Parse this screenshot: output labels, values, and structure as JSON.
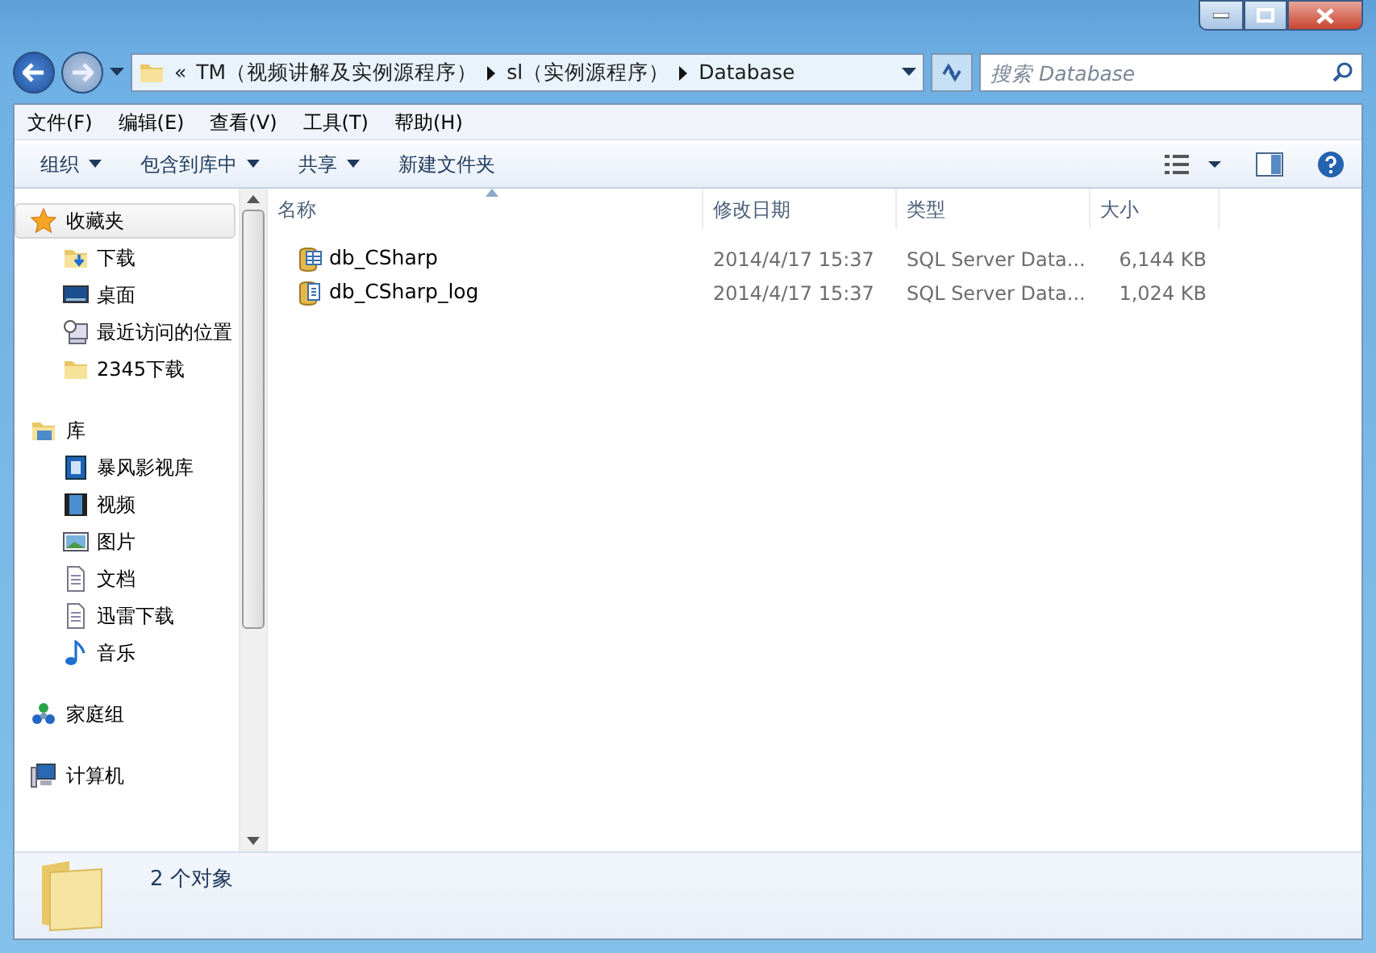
{
  "address": {
    "overflow": "«",
    "crumbs": [
      "TM（视频讲解及实例源程序）",
      "sl（实例源程序）",
      "Database"
    ]
  },
  "search": {
    "placeholder": "搜索 Database"
  },
  "menu": [
    "文件(F)",
    "编辑(E)",
    "查看(V)",
    "工具(T)",
    "帮助(H)"
  ],
  "toolbar": [
    {
      "label": "组织",
      "dropdown": true
    },
    {
      "label": "包含到库中",
      "dropdown": true
    },
    {
      "label": "共享",
      "dropdown": true
    },
    {
      "label": "新建文件夹",
      "dropdown": false
    }
  ],
  "navigation": [
    {
      "label": "收藏夹",
      "kind": "star",
      "selected": true,
      "children": [
        {
          "label": "下载",
          "kind": "download",
          "selected": false
        },
        {
          "label": "桌面",
          "kind": "desktop",
          "selected": false
        },
        {
          "label": "最近访问的位置",
          "kind": "recent",
          "selected": false
        },
        {
          "label": "2345下载",
          "kind": "folder",
          "selected": false
        }
      ]
    },
    {
      "label": "库",
      "kind": "library",
      "selected": false,
      "children": [
        {
          "label": "暴风影视库",
          "kind": "media",
          "selected": false
        },
        {
          "label": "视频",
          "kind": "video",
          "selected": false
        },
        {
          "label": "图片",
          "kind": "picture",
          "selected": false
        },
        {
          "label": "文档",
          "kind": "document",
          "selected": false
        },
        {
          "label": "迅雷下载",
          "kind": "document",
          "selected": false
        },
        {
          "label": "音乐",
          "kind": "music",
          "selected": false
        }
      ]
    },
    {
      "label": "家庭组",
      "kind": "homegroup",
      "selected": false
    },
    {
      "label": "计算机",
      "kind": "computer",
      "selected": false
    }
  ],
  "table": {
    "columns": [
      {
        "label": "名称",
        "sorted": true
      },
      {
        "label": "修改日期",
        "sorted": false
      },
      {
        "label": "类型",
        "sorted": false
      },
      {
        "label": "大小",
        "sorted": false
      }
    ],
    "rows": [
      {
        "kind": "database",
        "name": "db_CSharp",
        "modified": "2014/4/17 15:37",
        "type": "SQL Server Data...",
        "size": "6,144 KB"
      },
      {
        "kind": "log",
        "name": "db_CSharp_log",
        "modified": "2014/4/17 15:37",
        "type": "SQL Server Data...",
        "size": "1,024 KB"
      }
    ]
  },
  "status_bar": {
    "text": "2 个对象"
  }
}
